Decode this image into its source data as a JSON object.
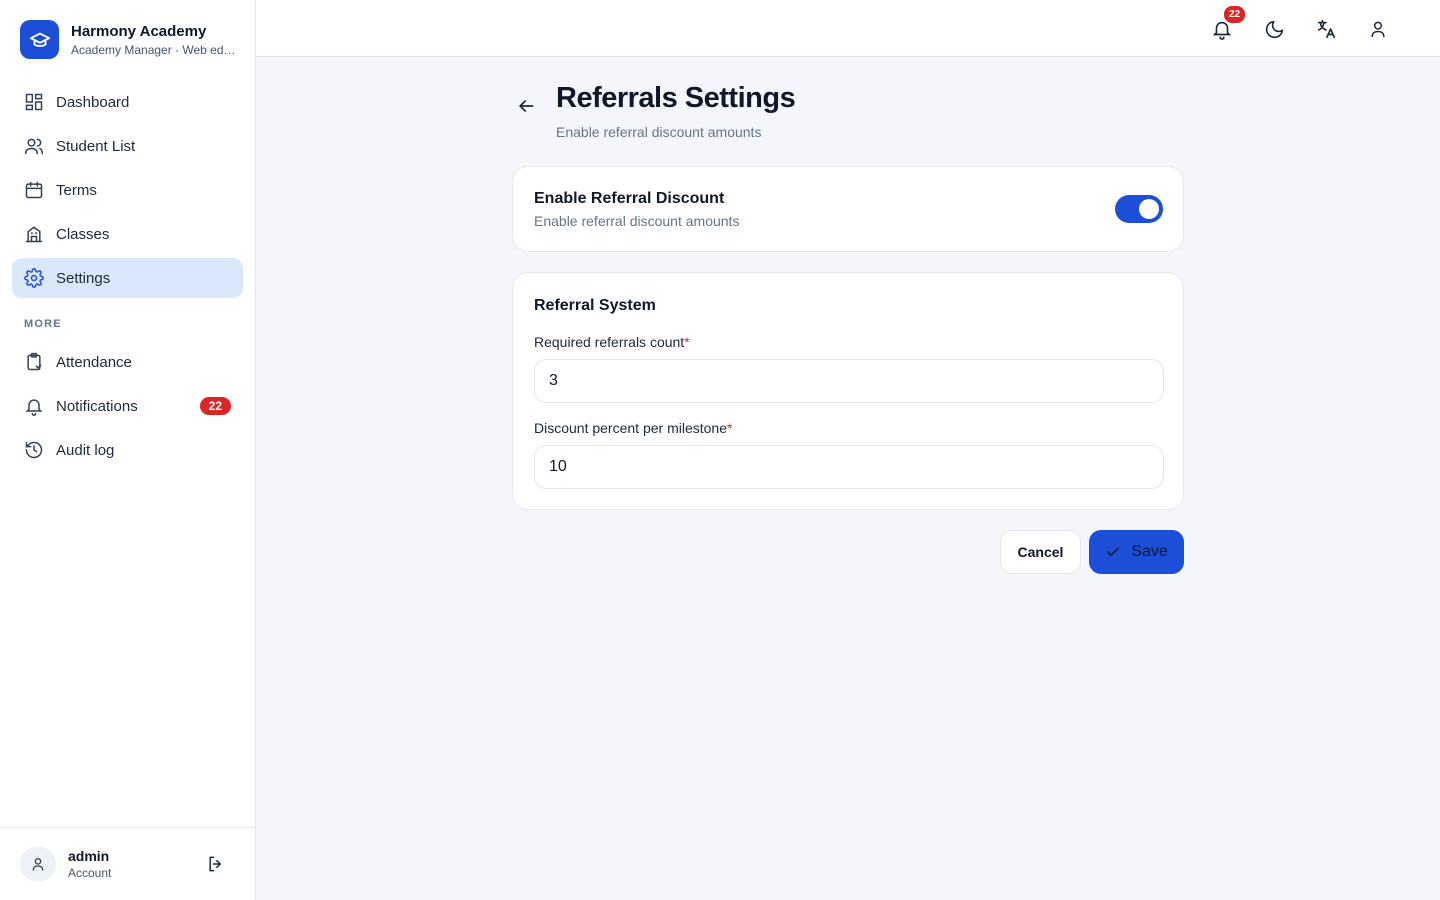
{
  "brand": {
    "name": "Harmony Academy",
    "subtitle": "Academy Manager · Web editor"
  },
  "sidebar": {
    "items": [
      {
        "label": "Dashboard",
        "icon": "dashboard-icon"
      },
      {
        "label": "Student List",
        "icon": "users-icon"
      },
      {
        "label": "Terms",
        "icon": "calendar-icon"
      },
      {
        "label": "Classes",
        "icon": "building-icon"
      },
      {
        "label": "Settings",
        "icon": "gear-icon",
        "active": true
      }
    ],
    "more_label": "MORE",
    "more_items": [
      {
        "label": "Attendance",
        "icon": "clipboard-icon"
      },
      {
        "label": "Notifications",
        "icon": "bell-icon",
        "badge": "22"
      },
      {
        "label": "Audit log",
        "icon": "history-icon"
      }
    ]
  },
  "account": {
    "name": "admin",
    "role": "Account"
  },
  "topbar": {
    "notification_count": "22"
  },
  "page": {
    "title": "Referrals Settings",
    "subtitle": "Enable referral discount amounts"
  },
  "discount_card": {
    "title": "Enable Referral Discount",
    "subtitle": "Enable referral discount amounts",
    "enabled": true
  },
  "referral_system": {
    "title": "Referral System",
    "fields": [
      {
        "label": "Required referrals count",
        "required_mark": "*",
        "value": "3"
      },
      {
        "label": "Discount percent per milestone",
        "required_mark": "*",
        "value": "10"
      }
    ]
  },
  "actions": {
    "cancel_label": "Cancel",
    "save_label": "Save"
  },
  "colors": {
    "accent": "#1d4ed8",
    "badge": "#dc2626",
    "active_nav": "#dbe7fb"
  }
}
